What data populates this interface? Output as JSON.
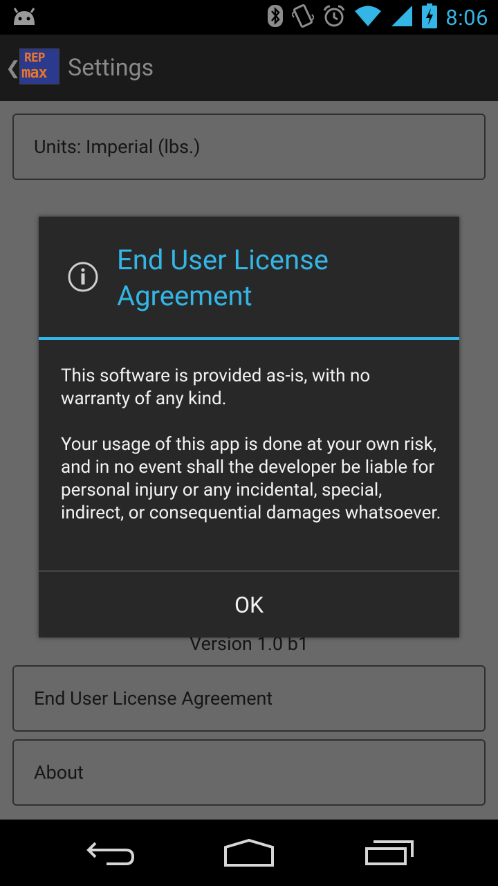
{
  "status_bar": {
    "time": "8:06",
    "icons": [
      "android-debug-icon",
      "bluetooth-icon",
      "vibrate-icon",
      "alarm-icon",
      "wifi-icon",
      "signal-icon",
      "battery-charging-icon"
    ]
  },
  "action_bar": {
    "logo_line1": "REP",
    "logo_line2": "max",
    "title": "Settings"
  },
  "settings": {
    "units_label": "Units: Imperial (lbs.)",
    "version": "Version 1.0 b1",
    "eula_label": "End User License Agreement",
    "about_label": "About"
  },
  "dialog": {
    "title": "End User License Agreement",
    "message_p1": "This software is provided as-is, with no warranty of any kind.",
    "message_p2": "Your usage of this app is done at your own risk, and in no event shall the developer be liable for personal injury or any incidental, special, indirect, or consequential damages whatsoever.",
    "ok_label": "OK"
  },
  "colors": {
    "accent": "#33b5e5",
    "background": "#696969",
    "dialog": "#282828"
  }
}
